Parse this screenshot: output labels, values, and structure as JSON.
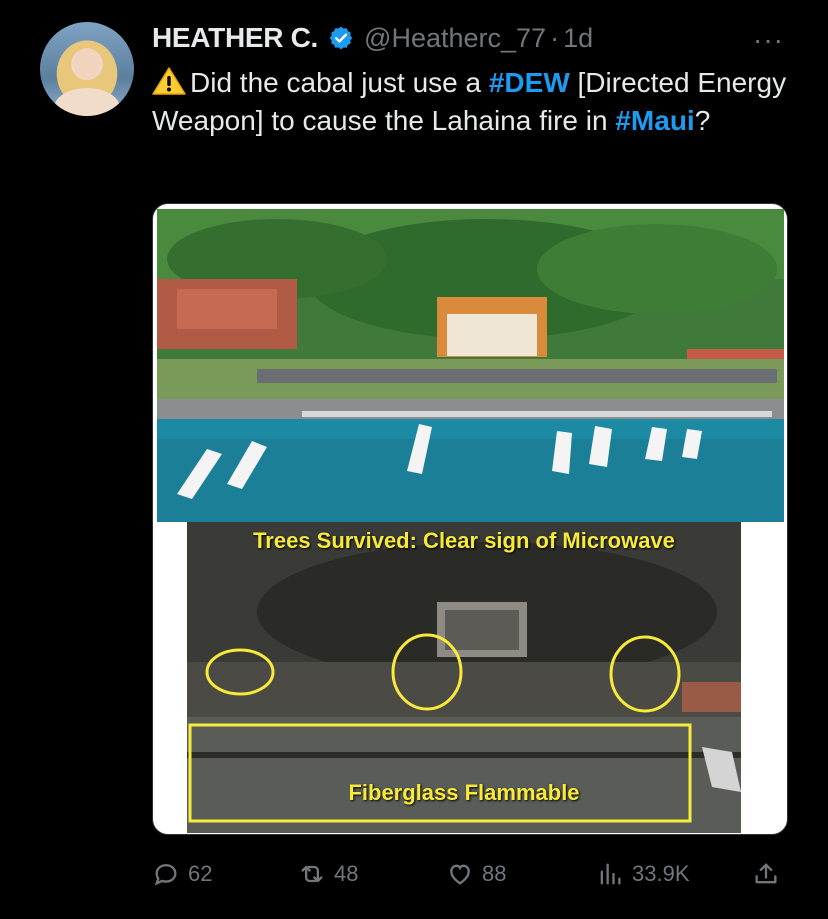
{
  "tweet": {
    "author_name": "HEATHER C.",
    "handle": "@Heatherc_77",
    "separator": "·",
    "time": "1d",
    "more_label": "···",
    "text_part1": "Did the cabal just use a ",
    "tag1": "#DEW",
    "text_part2": " [Directed Energy Weapon] to cause the Lahaina fire in ",
    "tag2": "#Maui",
    "text_part3": "?",
    "warning_icon": "warning-icon"
  },
  "media": {
    "top_photo": "aerial harbor with boats and banyan tree (before)",
    "overlay_title": "Trees Survived: Clear sign of Microwave",
    "overlay_bottom": "Fiberglass Flammable"
  },
  "actions": {
    "replies": "62",
    "retweets": "48",
    "likes": "88",
    "views": "33.9K"
  },
  "colors": {
    "background": "#000000",
    "text": "#e7e9ea",
    "muted": "#71767b",
    "accent": "#1d9bf0",
    "annotation_yellow": "#f7ea3a"
  }
}
